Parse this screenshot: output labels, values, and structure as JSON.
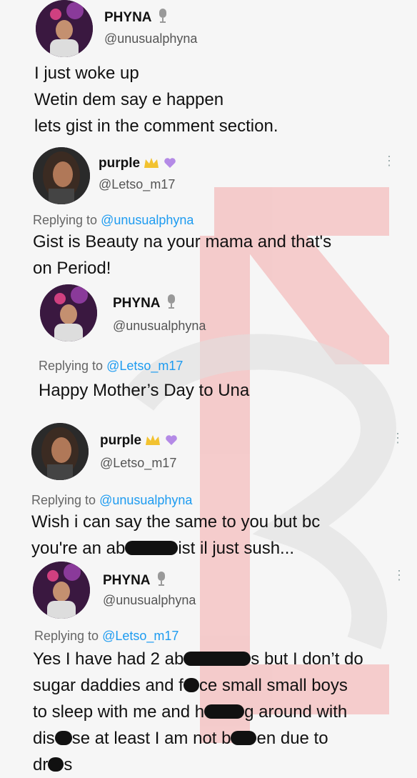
{
  "tweets": [
    {
      "name": "PHYNA",
      "handle": "@unusualphyna",
      "body": [
        "I just woke up",
        "Wetin dem say e happen",
        "lets gist in the comment section."
      ]
    },
    {
      "name": "purple",
      "handle": "@Letso_m17",
      "replying_prefix": "Replying to ",
      "replying_to": "@unusualphyna",
      "body": [
        "Gist is Beauty na your mama and that's",
        "on Period!"
      ]
    },
    {
      "name": "PHYNA",
      "handle": "@unusualphyna",
      "replying_prefix": "Replying to ",
      "replying_to": "@Letso_m17",
      "body": [
        "Happy Mother’s Day to Una"
      ]
    },
    {
      "name": "purple",
      "handle": "@Letso_m17",
      "replying_prefix": "Replying to ",
      "replying_to": "@unusualphyna",
      "body_line1": "Wish i can say the same to you but bc",
      "body_line2_a": "you're an ab",
      "body_line2_b": "ist il just sush..."
    },
    {
      "name": "PHYNA",
      "handle": "@unusualphyna",
      "replying_prefix": "Replying to ",
      "replying_to": "@Letso_m17",
      "l1a": "Yes I have had 2 ab",
      "l1b": "s but I don’t do",
      "l2a": "sugar daddies and f",
      "l2b": "ce small small boys",
      "l3a": "to sleep with me and h",
      "l3b": "g around with",
      "l4a": "dis",
      "l4b": "se at least I am not b",
      "l4c": "en due to",
      "l5a": "dr",
      "l5b": "s"
    }
  ],
  "icons": {
    "verified_badge": "microphone-badge-icon",
    "crown": "crown-icon",
    "heart": "purple-heart-icon",
    "more": "more-options-icon"
  },
  "colors": {
    "link": "#1d9bf0",
    "watermark": "#f4a3a3",
    "text": "#111111",
    "muted": "#666666"
  }
}
